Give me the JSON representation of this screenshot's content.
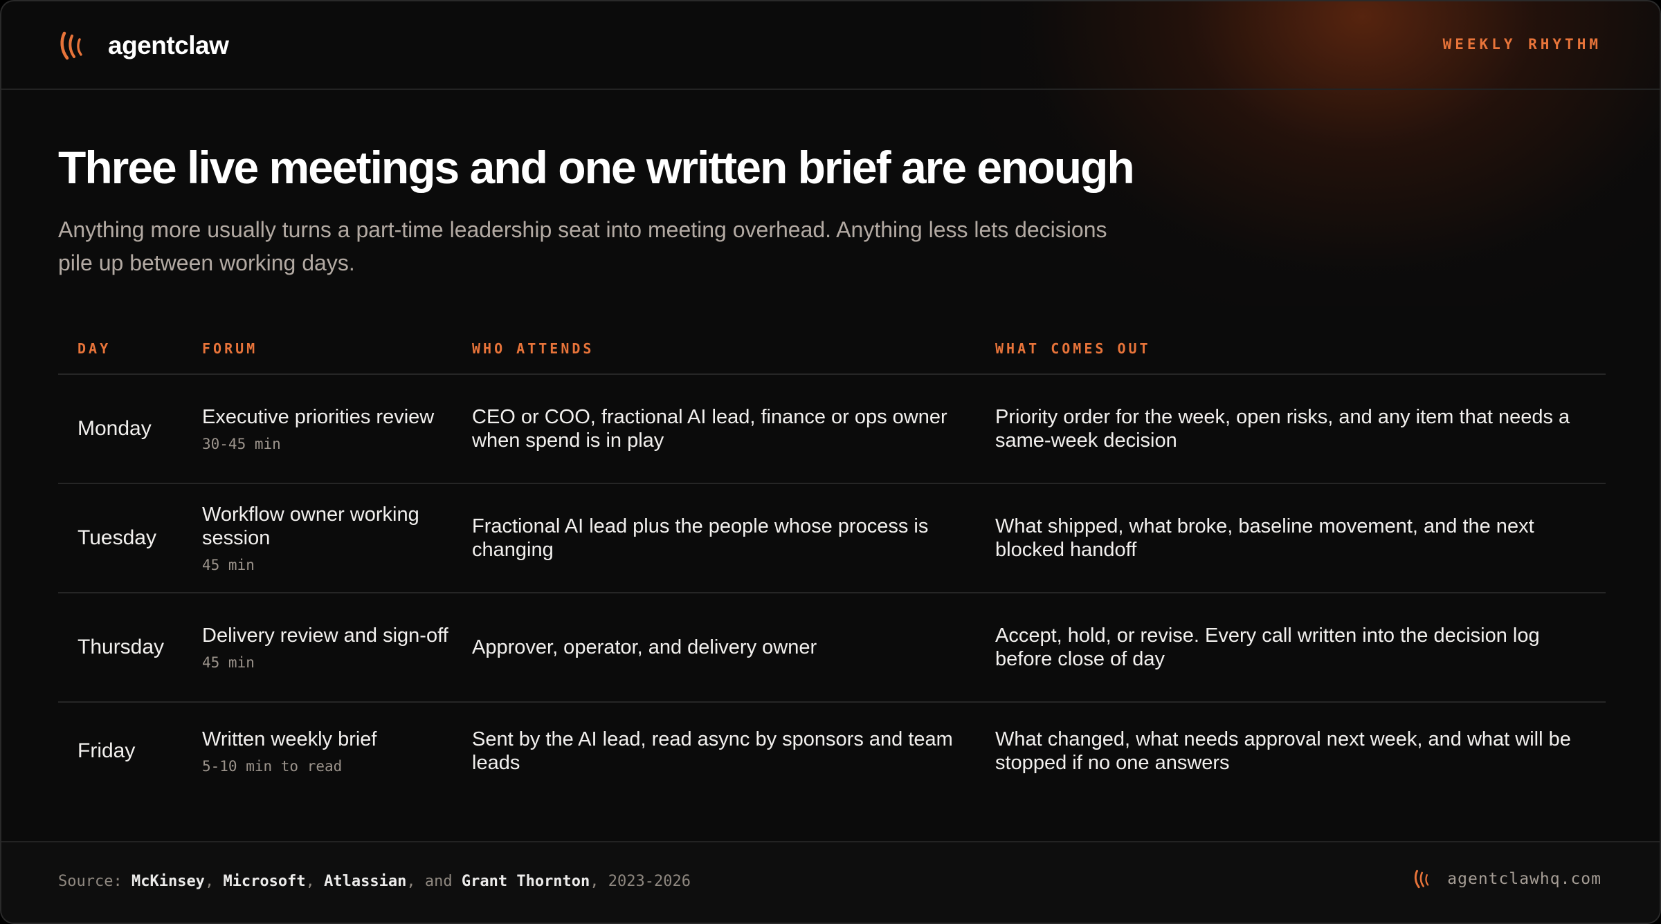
{
  "brand": {
    "name": "agentclaw",
    "icon": "claw-marks-icon",
    "accent": "#e8743a",
    "website": "agentclawhq.com"
  },
  "section_tag": "WEEKLY RHYTHM",
  "title": "Three live meetings and one written brief are enough",
  "subtitle": "Anything more usually turns a part-time leadership seat into meeting overhead. Anything less lets decisions pile up between working days.",
  "table": {
    "headers": [
      "DAY",
      "FORUM",
      "WHO ATTENDS",
      "WHAT COMES OUT"
    ],
    "rows": [
      {
        "day": "Monday",
        "forum": "Executive priorities review",
        "duration": "30-45 min",
        "attendees": "CEO or COO, fractional AI lead, finance or ops owner when spend is in play",
        "output": "Priority order for the week, open risks, and any item that needs a same-week decision"
      },
      {
        "day": "Tuesday",
        "forum": "Workflow owner working session",
        "duration": "45 min",
        "attendees": "Fractional AI lead plus the people whose process is changing",
        "output": "What shipped, what broke, baseline movement, and the next blocked handoff"
      },
      {
        "day": "Thursday",
        "forum": "Delivery review and sign-off",
        "duration": "45 min",
        "attendees": "Approver, operator, and delivery owner",
        "output": "Accept, hold, or revise. Every call written into the decision log before close of day"
      },
      {
        "day": "Friday",
        "forum": "Written weekly brief",
        "duration": "5-10 min to read",
        "attendees": "Sent by the AI lead, read async by sponsors and team leads",
        "output": "What changed, what needs approval next week, and what will be stopped if no one answers"
      }
    ]
  },
  "footer": {
    "source_label": "Source:",
    "sources": [
      "McKinsey",
      "Microsoft",
      "Atlassian",
      "Grant Thornton"
    ],
    "sep1": ",",
    "sep2": ",",
    "sep3": ", and",
    "years": ", 2023-2026"
  }
}
